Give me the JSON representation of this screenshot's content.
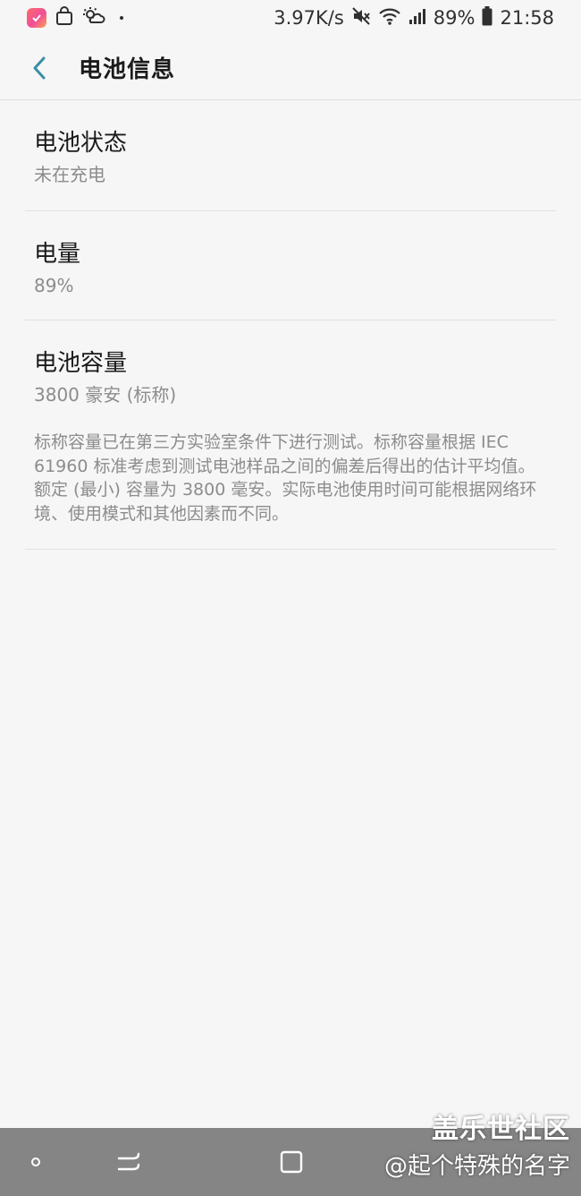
{
  "status_bar": {
    "network_speed": "3.97K/s",
    "battery_percent": "89%",
    "time": "21:58",
    "icons": [
      "app-badge-icon",
      "shopping-bag-icon",
      "weather-icon",
      "mute-icon",
      "wifi-icon",
      "signal-icon",
      "battery-icon"
    ]
  },
  "app_bar": {
    "title": "电池信息",
    "back_icon": "chevron-left-icon",
    "accent_color": "#3a8ea6"
  },
  "items": {
    "status": {
      "title": "电池状态",
      "value": "未在充电"
    },
    "level": {
      "title": "电量",
      "value": "89%"
    },
    "capacity": {
      "title": "电池容量",
      "value": "3800 豪安 (标称)",
      "description": "标称容量已在第三方实验室条件下进行测试。标称容量根据 IEC 61960 标准考虑到测试电池样品之间的偏差后得出的估计平均值。额定 (最小) 容量为 3800 毫安。实际电池使用时间可能根据网络环境、使用模式和其他因素而不同。"
    }
  },
  "nav_bar": {
    "buttons": [
      "recent-apps-icon",
      "back-icon",
      "home-icon"
    ]
  },
  "watermark": {
    "brand": "盖乐世社区",
    "user": "@起个特殊的名字"
  }
}
